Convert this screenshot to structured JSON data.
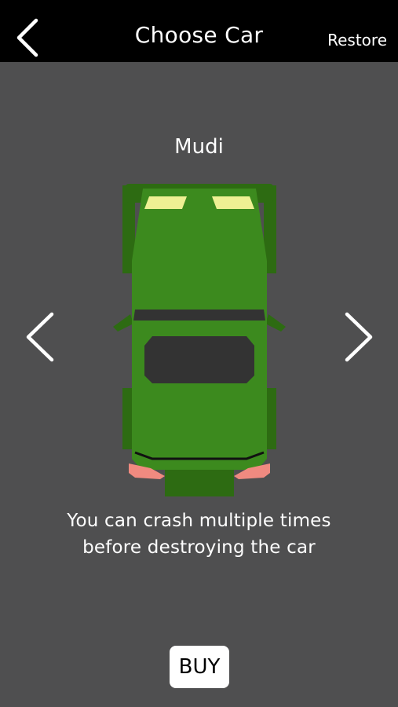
{
  "header": {
    "title": "Choose Car",
    "restore_label": "Restore",
    "back_icon": "chevron-left-icon"
  },
  "car": {
    "name": "Mudi",
    "description_line1": "You can crash multiple times",
    "description_line2": "before destroying the car",
    "body_color": "#3c8a1e",
    "dark_green": "#2d6b12",
    "headlight_color": "#eef093",
    "taillight_color": "#f08a80",
    "window_color": "#333333"
  },
  "navigation": {
    "prev_icon": "chevron-left-icon",
    "next_icon": "chevron-right-icon"
  },
  "buy_label": "BUY",
  "colors": {
    "background": "#4f4f50",
    "topbar": "#000000",
    "text": "#ffffff"
  }
}
